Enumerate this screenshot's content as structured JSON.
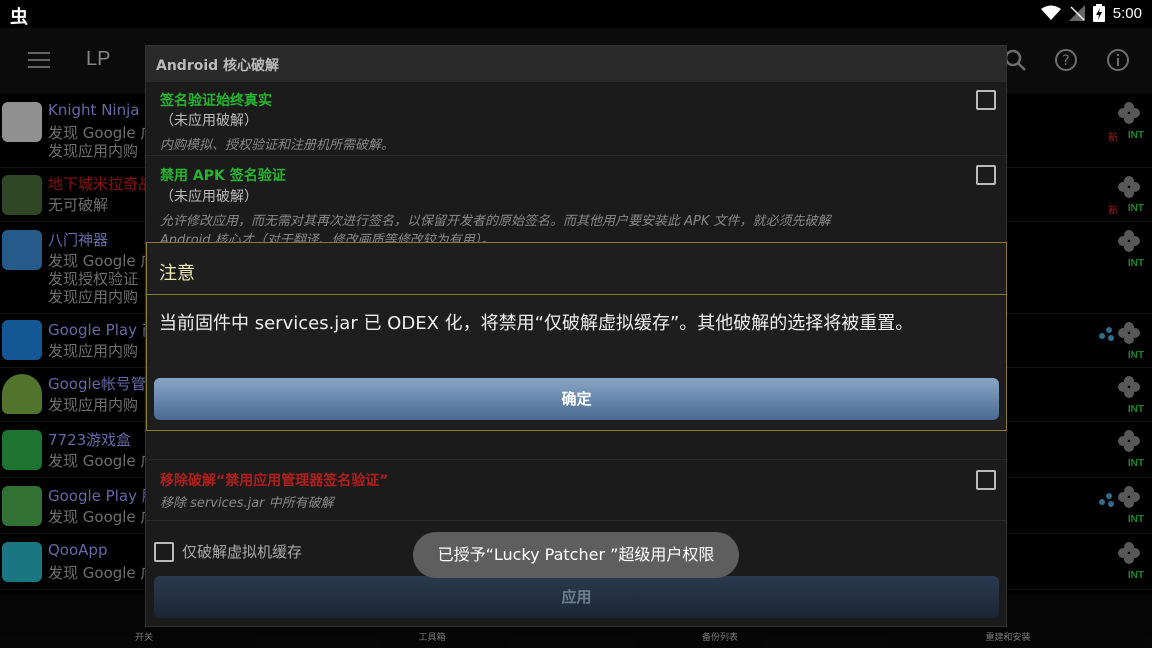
{
  "status_bar": {
    "time": "5:00",
    "app_glyph": "虫"
  },
  "app_bar": {
    "title": "LP"
  },
  "apps": [
    {
      "name": "Knight Ninja C",
      "lines": [
        "发现 Google 广",
        "发现应用内购"
      ],
      "name_color": "#9f9fff",
      "new_tag": "新",
      "int_tag": "INT"
    },
    {
      "name": "地下城米拉奇战",
      "lines": [
        "无可破解"
      ],
      "name_color": "#d81e1e",
      "new_tag": "新",
      "int_tag": "INT"
    },
    {
      "name": "八门神器",
      "lines": [
        "发现 Google 广",
        "发现授权验证",
        "发现应用内购"
      ],
      "name_color": "#9f9fff",
      "int_tag": "INT"
    },
    {
      "name": "Google Play 商",
      "lines": [
        "发现应用内购"
      ],
      "name_color": "#9f9fff",
      "int_tag": "INT"
    },
    {
      "name": "Google帐号管理",
      "lines": [
        "发现应用内购"
      ],
      "name_color": "#9f9fff",
      "int_tag": "INT"
    },
    {
      "name": "7723游戏盒",
      "lines": [
        "发现 Google 广"
      ],
      "name_color": "#9f9fff",
      "int_tag": "INT"
    },
    {
      "name": "Google Play 服",
      "lines": [
        "发现 Google 广"
      ],
      "name_color": "#9f9fff",
      "int_tag": "INT"
    },
    {
      "name": "QooApp",
      "lines": [
        "发现 Google 广"
      ],
      "name_color": "#9f9fff",
      "int_tag": "INT"
    }
  ],
  "bottom_bar": {
    "items": [
      "开关",
      "工具箱",
      "备份列表",
      "重建和安装"
    ]
  },
  "core_dialog": {
    "title": "Android 核心破解",
    "options": [
      {
        "title": "签名验证始终真实",
        "status": "（未应用破解）",
        "desc": "内购模拟、授权验证和注册机所需破解。"
      },
      {
        "title": "禁用 APK 签名验证",
        "status": "（未应用破解）",
        "desc": "允许修改应用，而无需对其再次进行签名，以保留开发者的原始签名。而其他用户要安装此 APK 文件，就必须先破解",
        "desc2": "Android 核心才（对于翻译、修改画质等修改较为有用）。"
      }
    ],
    "remove_option": {
      "title": "移除破解“禁用应用管理器签名验证”",
      "desc": "移除 services.jar 中所有破解"
    },
    "odex_label": "仅破解虚拟机缓存",
    "apply_label": "应用"
  },
  "alert": {
    "title": "注意",
    "message": "当前固件中 services.jar 已 ODEX 化，将禁用“仅破解虚拟缓存”。其他破解的选择将被重置。",
    "ok_label": "确定"
  },
  "toast": {
    "text": "已授予“Lucky Patcher ”超级用户权限"
  },
  "colors": {
    "accent_green": "#25b52e",
    "warning_red": "#b01e1e",
    "int_green": "#2ecc40",
    "alert_border": "#8a7a30"
  }
}
